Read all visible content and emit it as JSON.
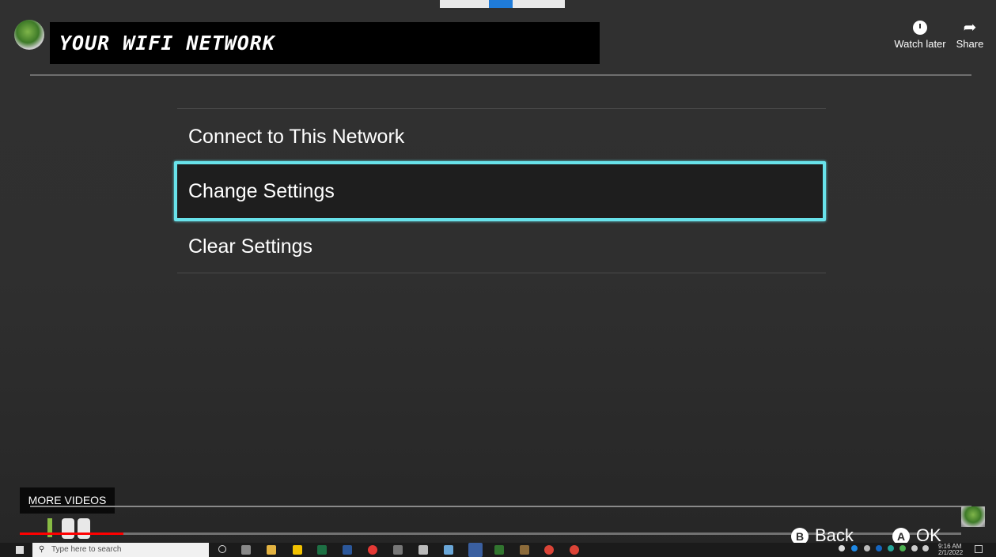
{
  "video": {
    "title": "YOUR WIFI NETWORK",
    "actions": {
      "watch_later": "Watch later",
      "share": "Share"
    },
    "more_videos": "MORE VIDEOS",
    "progress_fraction": 0.11
  },
  "menu": {
    "items": [
      {
        "label": "Connect to This Network",
        "selected": false
      },
      {
        "label": "Change Settings",
        "selected": true
      },
      {
        "label": "Clear Settings",
        "selected": false
      }
    ]
  },
  "controls": {
    "back": {
      "button": "B",
      "label": "Back"
    },
    "ok": {
      "button": "A",
      "label": "OK"
    }
  },
  "taskbar": {
    "search_placeholder": "Type here to search",
    "time": "9:16 AM",
    "date": "2/1/2022"
  },
  "colors": {
    "selection_border": "#68e2ea",
    "progress": "#ff0000",
    "background": "#2f2f2f"
  }
}
